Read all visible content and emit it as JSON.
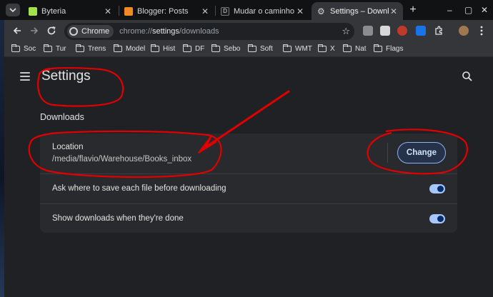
{
  "tabs": [
    {
      "title": "Byteria",
      "favicon_color": "#9fe24b",
      "close": "✕"
    },
    {
      "title": "Blogger: Posts",
      "favicon_color": "#f08a24",
      "close": "✕"
    },
    {
      "title": "Mudar o caminho d",
      "favicon_color": "#1c1c1c",
      "close": "✕"
    },
    {
      "title": "Settings – Downloa",
      "favicon_color": "#9aa0a6",
      "close": "✕"
    }
  ],
  "window_controls": {
    "minimize": "–",
    "maximize": "▢",
    "close": "✕"
  },
  "newtab_label": "+",
  "omnibox": {
    "chip_label": "Chrome",
    "url_prefix": "chrome://",
    "url_host": "settings",
    "url_path": "/downloads"
  },
  "bookmarks": [
    "Soc",
    "Tur",
    "Trens",
    "Model",
    "Hist",
    "DF",
    "Sebo",
    "Soft",
    "WMT",
    "X",
    "Nat",
    "Flags"
  ],
  "settings": {
    "title": "Settings",
    "section_title": "Downloads",
    "location_label": "Location",
    "location_path": "/media/flavio/Warehouse/Books_inbox",
    "change_button": "Change",
    "ask_label": "Ask where to save each file before downloading",
    "ask_enabled": true,
    "show_label": "Show downloads when they're done",
    "show_enabled": true
  },
  "colors": {
    "accent": "#8ab4f8",
    "toggle_on": "#a8c7fa",
    "annotation": "#e00000"
  }
}
